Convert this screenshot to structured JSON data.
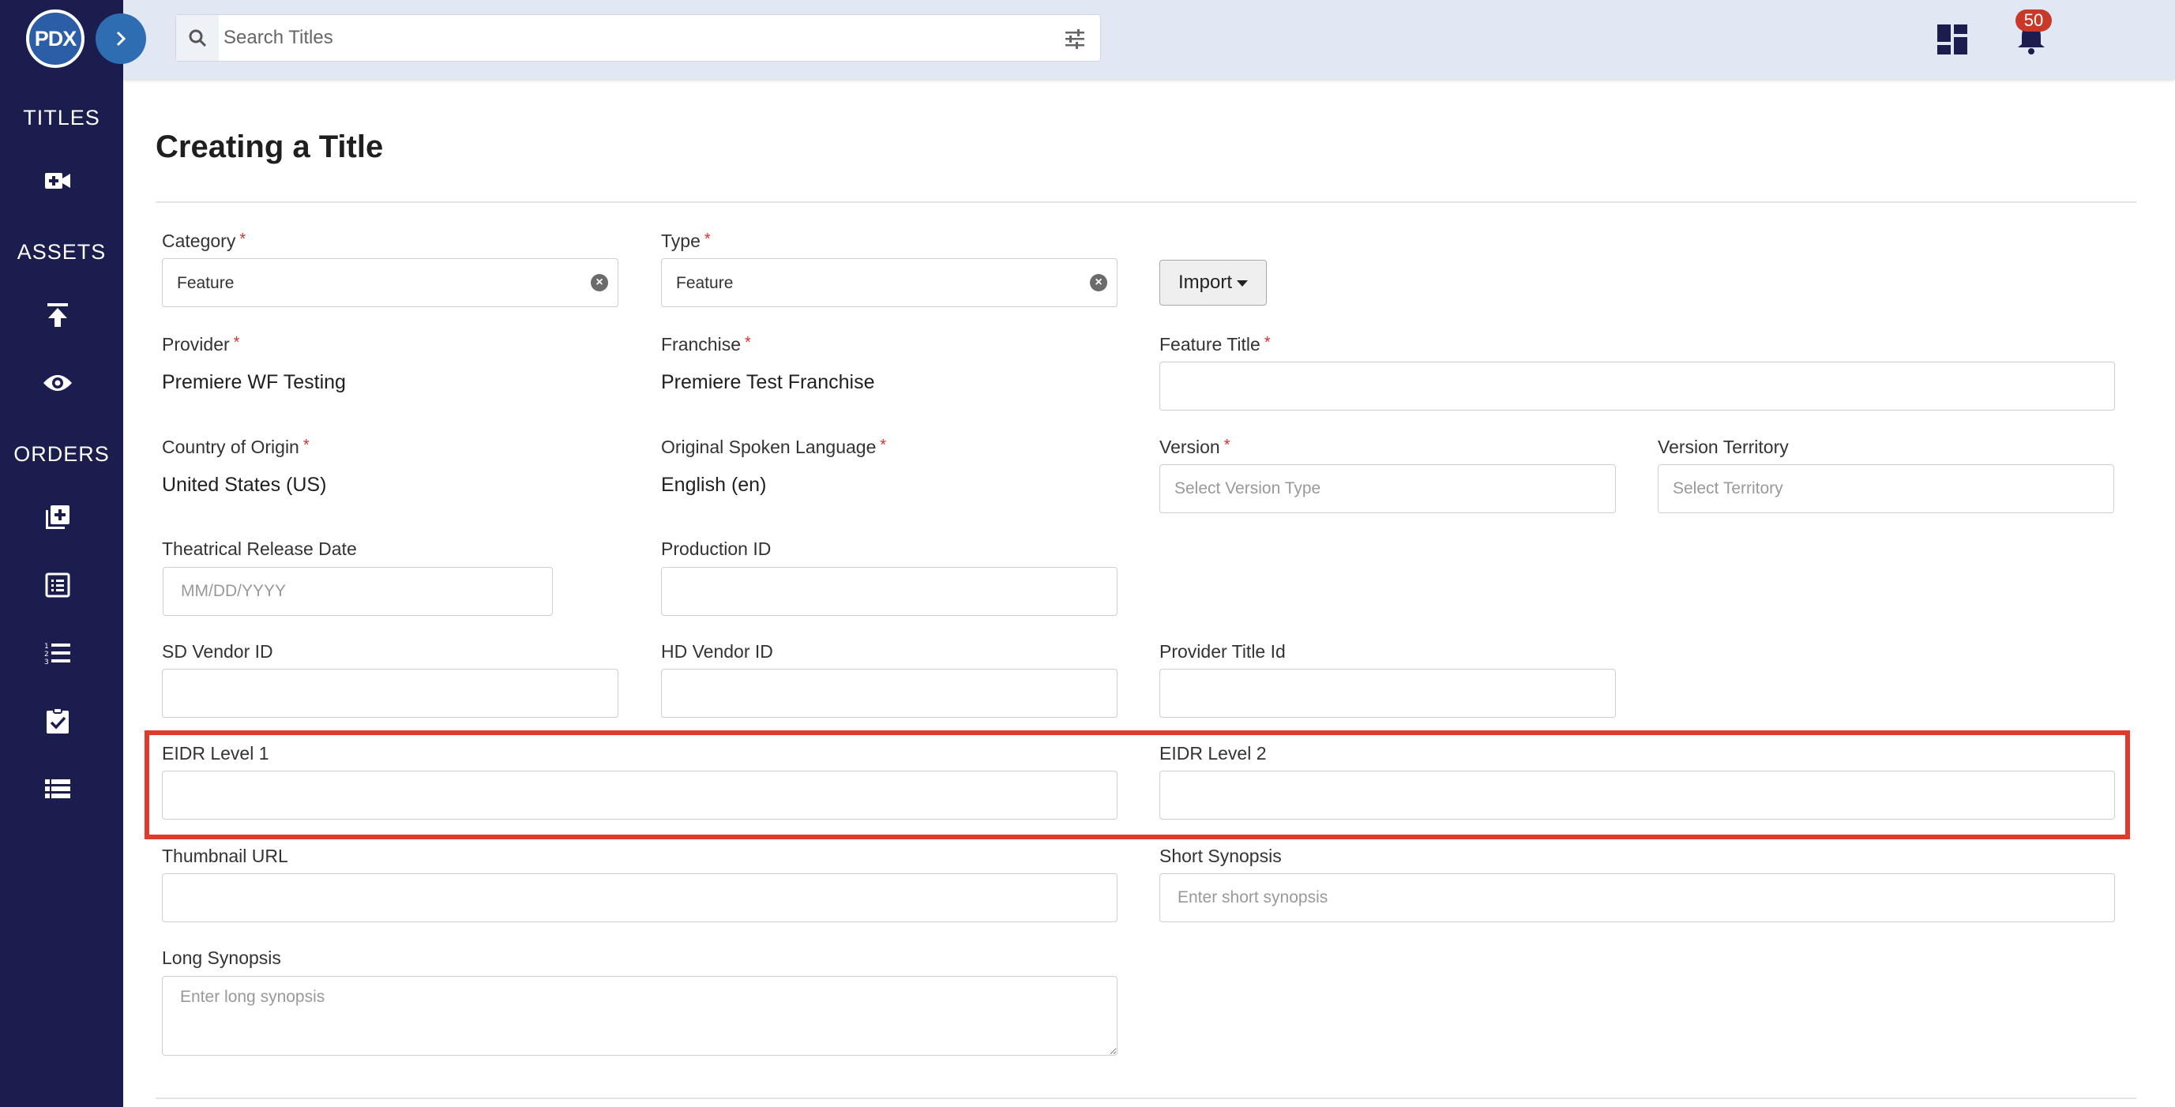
{
  "sidebar": {
    "logo_text": "PDX",
    "sections": [
      {
        "label": "TITLES",
        "icons": [
          "video-add-icon"
        ]
      },
      {
        "label": "ASSETS",
        "icons": [
          "upload-icon",
          "eye-icon"
        ]
      },
      {
        "label": "ORDERS",
        "icons": [
          "library-add-icon",
          "list-alt-icon",
          "numbered-list-icon",
          "assignment-check-icon",
          "view-list-icon"
        ]
      }
    ]
  },
  "topbar": {
    "search_placeholder": "Search Titles",
    "notification_count": "50"
  },
  "page": {
    "title": "Creating a Title"
  },
  "form": {
    "category": {
      "label": "Category",
      "value": "Feature"
    },
    "type": {
      "label": "Type",
      "value": "Feature"
    },
    "import_label": "Import",
    "provider": {
      "label": "Provider",
      "value": "Premiere WF Testing"
    },
    "franchise": {
      "label": "Franchise",
      "value": "Premiere Test Franchise"
    },
    "feature_title": {
      "label": "Feature Title",
      "value": ""
    },
    "country": {
      "label": "Country of Origin",
      "value": "United States (US)"
    },
    "language": {
      "label": "Original Spoken Language",
      "value": "English (en)"
    },
    "version": {
      "label": "Version",
      "placeholder": "Select Version Type"
    },
    "version_territory": {
      "label": "Version Territory",
      "placeholder": "Select Territory"
    },
    "release_date": {
      "label": "Theatrical Release Date",
      "placeholder": "MM/DD/YYYY"
    },
    "production_id": {
      "label": "Production ID",
      "value": ""
    },
    "sd_vendor_id": {
      "label": "SD Vendor ID",
      "value": ""
    },
    "hd_vendor_id": {
      "label": "HD Vendor ID",
      "value": ""
    },
    "provider_title_id": {
      "label": "Provider Title Id",
      "value": ""
    },
    "eidr1": {
      "label": "EIDR Level 1",
      "value": ""
    },
    "eidr2": {
      "label": "EIDR Level 2",
      "value": ""
    },
    "thumbnail_url": {
      "label": "Thumbnail URL",
      "value": ""
    },
    "short_synopsis": {
      "label": "Short Synopsis",
      "placeholder": "Enter short synopsis"
    },
    "long_synopsis": {
      "label": "Long Synopsis",
      "placeholder": "Enter long synopsis"
    }
  },
  "colors": {
    "sidebar_bg": "#1b1d4f",
    "topbar_bg": "#e1e8f4",
    "accent": "#2f6db3",
    "required": "#d63030",
    "highlight": "#e03a2b",
    "badge": "#c9392a"
  }
}
